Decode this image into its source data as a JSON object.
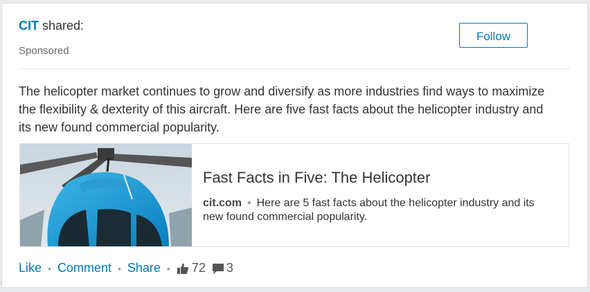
{
  "post": {
    "company": "CIT",
    "shared_suffix": " shared:",
    "sponsored": "Sponsored",
    "follow_label": "Follow",
    "commentary": "The helicopter market continues to grow and diversify as more industries find ways to maximize the flexibility & dexterity of this aircraft. Here are five fast facts about the helicopter industry and its new found commercial popularity."
  },
  "link_preview": {
    "title": "Fast Facts in Five: The Helicopter",
    "domain": "cit.com",
    "description": "Here are 5 fast facts about the helicopter industry and its new found commercial popularity.",
    "image_icon": "helicopter-image"
  },
  "actions": {
    "like": "Like",
    "comment": "Comment",
    "share": "Share",
    "likes_count": "72",
    "comments_count": "3",
    "like_icon": "thumbs-up-icon",
    "comment_icon": "speech-bubble-icon"
  },
  "colors": {
    "link_blue": "#0077b5",
    "text": "#333333",
    "muted": "#666666",
    "background": "#e9eaeb"
  }
}
